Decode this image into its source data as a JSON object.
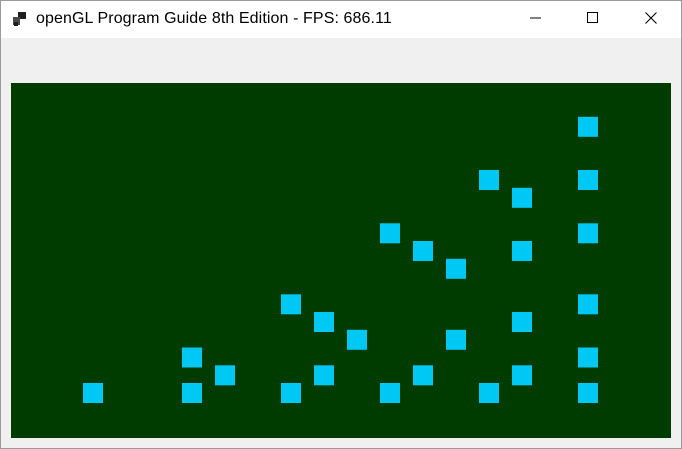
{
  "window": {
    "title": "openGL Program Guide 8th Edition - FPS: 686.11",
    "icons": {
      "app": "opengl-app-icon",
      "minimize": "minimize-icon",
      "maximize": "maximize-icon",
      "close": "close-icon"
    }
  },
  "colors": {
    "titlebar_bg": "#ffffff",
    "client_bg": "#f0f0f0",
    "canvas_bg": "#003c00",
    "square_fill": "#00c8f5"
  },
  "render": {
    "grid": [
      {
        "col": 0,
        "row": 0
      },
      {
        "col": 3,
        "row": 0
      },
      {
        "col": 6,
        "row": 0
      },
      {
        "col": 9,
        "row": 0
      },
      {
        "col": 12,
        "row": 0
      },
      {
        "col": 15,
        "row": 0
      },
      {
        "col": 4,
        "row": 1
      },
      {
        "col": 7,
        "row": 1
      },
      {
        "col": 10,
        "row": 1
      },
      {
        "col": 13,
        "row": 1
      },
      {
        "col": 3,
        "row": 2
      },
      {
        "col": 15,
        "row": 2
      },
      {
        "col": 8,
        "row": 3
      },
      {
        "col": 11,
        "row": 3
      },
      {
        "col": 7,
        "row": 4
      },
      {
        "col": 13,
        "row": 4
      },
      {
        "col": 6,
        "row": 5
      },
      {
        "col": 15,
        "row": 5
      },
      {
        "col": 11,
        "row": 7
      },
      {
        "col": 10,
        "row": 8
      },
      {
        "col": 13,
        "row": 8
      },
      {
        "col": 9,
        "row": 9
      },
      {
        "col": 15,
        "row": 9
      },
      {
        "col": 13,
        "row": 11
      },
      {
        "col": 12,
        "row": 12
      },
      {
        "col": 15,
        "row": 12
      },
      {
        "col": 15,
        "row": 15
      }
    ]
  }
}
